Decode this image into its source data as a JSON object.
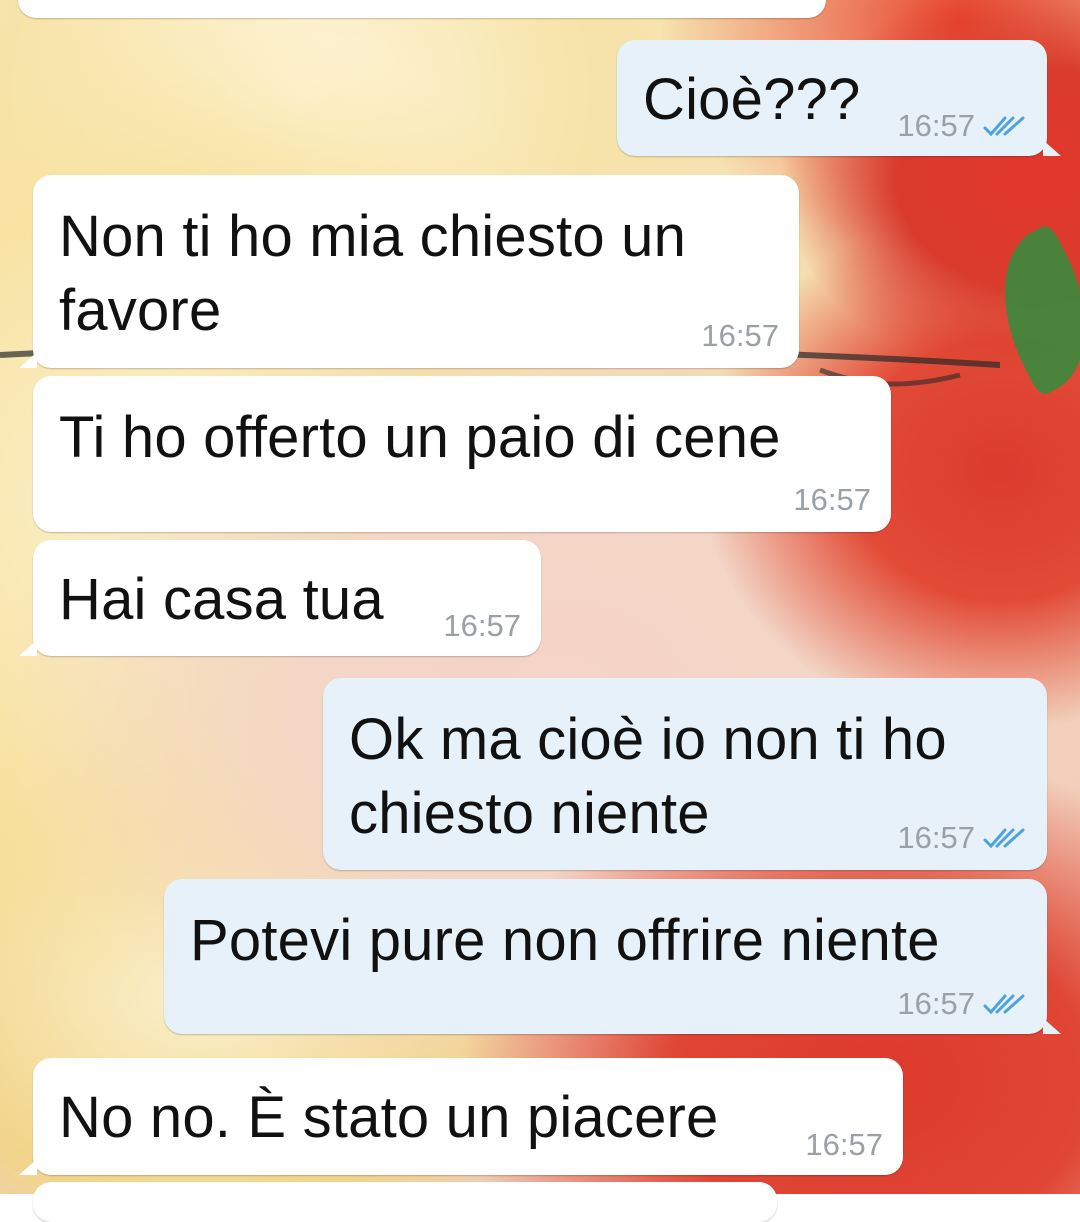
{
  "colors": {
    "incoming_bubble": "#ffffff",
    "outgoing_bubble": "#e6f1f9",
    "timestamp": "#9aa0a6",
    "read_checks": "#4fa3dd",
    "text": "#111111"
  },
  "messages": [
    {
      "id": "m1",
      "direction": "outgoing",
      "text": "Cioè???",
      "time": "16:57",
      "status": "read",
      "status_icon": "double-check-icon"
    },
    {
      "id": "m2",
      "direction": "incoming",
      "lines": [
        "Non ti ho mia chiesto un",
        "favore"
      ],
      "time": "16:57"
    },
    {
      "id": "m3",
      "direction": "incoming",
      "text": "Ti ho offerto un paio di cene",
      "time": "16:57"
    },
    {
      "id": "m4",
      "direction": "incoming",
      "text": "Hai casa tua",
      "time": "16:57"
    },
    {
      "id": "m5",
      "direction": "outgoing",
      "lines": [
        "Ok ma cioè io non ti ho",
        "chiesto niente"
      ],
      "time": "16:57",
      "status": "read",
      "status_icon": "double-check-icon"
    },
    {
      "id": "m6",
      "direction": "outgoing",
      "text": "Potevi pure non offrire niente",
      "time": "16:57",
      "status": "read",
      "status_icon": "double-check-icon"
    },
    {
      "id": "m7",
      "direction": "incoming",
      "text": "No no. È stato un piacere",
      "time": "16:57"
    }
  ]
}
